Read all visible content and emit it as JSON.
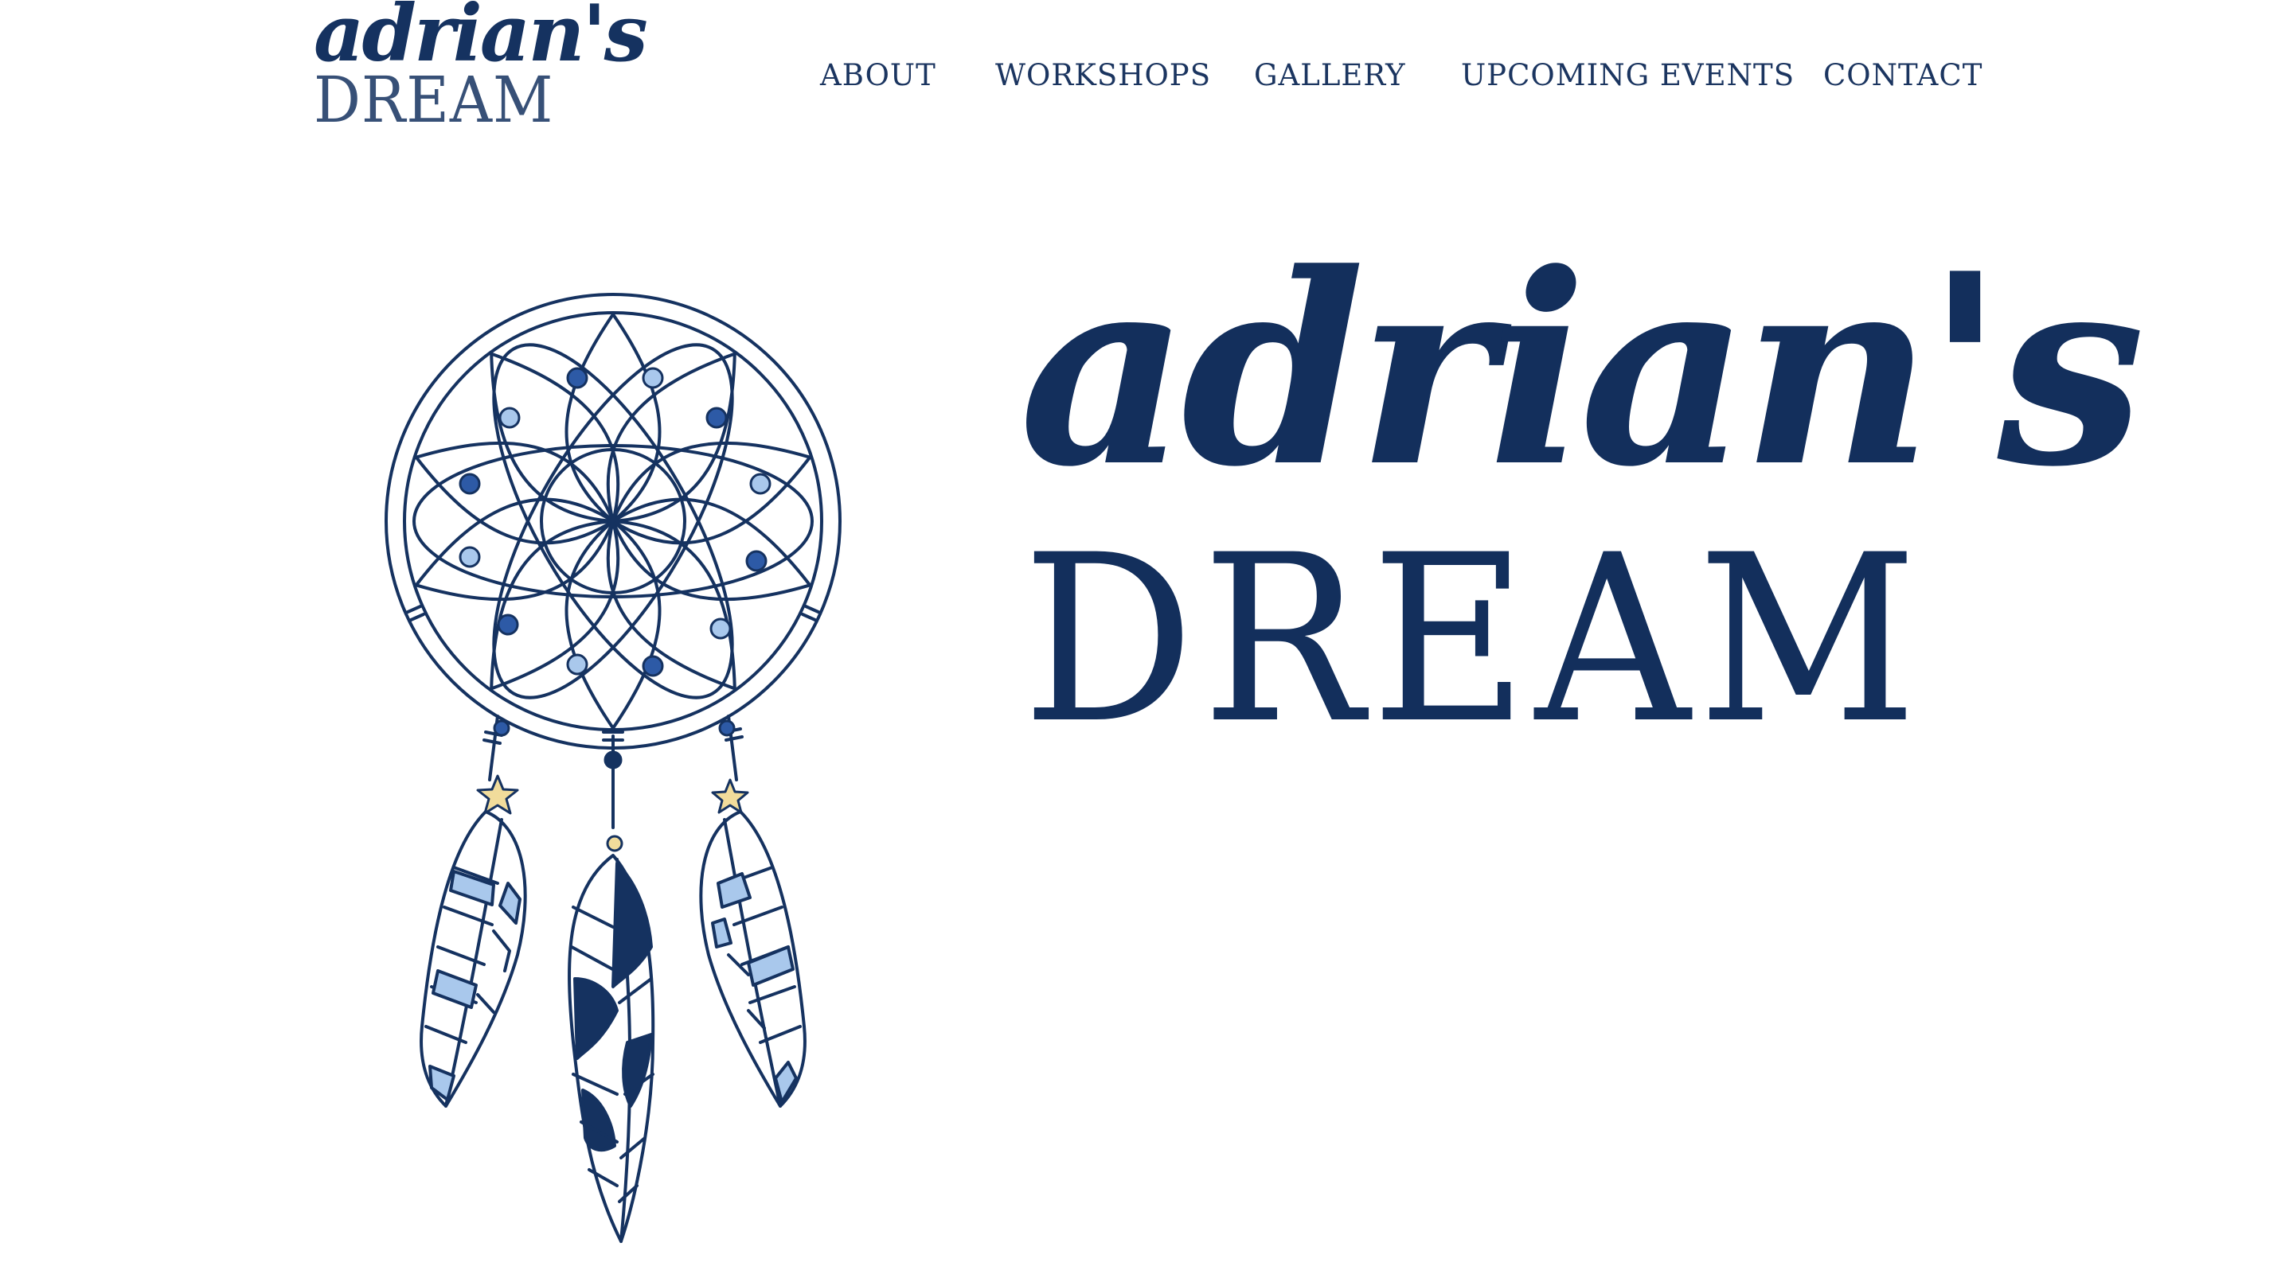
{
  "site": {
    "logo": {
      "script": "adrian's",
      "caps": "DREAM"
    }
  },
  "nav": {
    "items": [
      {
        "label": "ABOUT"
      },
      {
        "label": "WORKSHOPS"
      },
      {
        "label": "GALLERY"
      },
      {
        "label": "UPCOMING EVENTS"
      },
      {
        "label": "CONTACT"
      }
    ]
  },
  "hero": {
    "title_script": "adrian's",
    "title_caps": "DREAM",
    "illustration": "dreamcatcher-icon"
  },
  "colors": {
    "navy": "#153260",
    "light_blue": "#a9c8ec",
    "mid_blue": "#2d5aa6",
    "star_yellow": "#f1dc9b",
    "background": "#ffffff"
  }
}
